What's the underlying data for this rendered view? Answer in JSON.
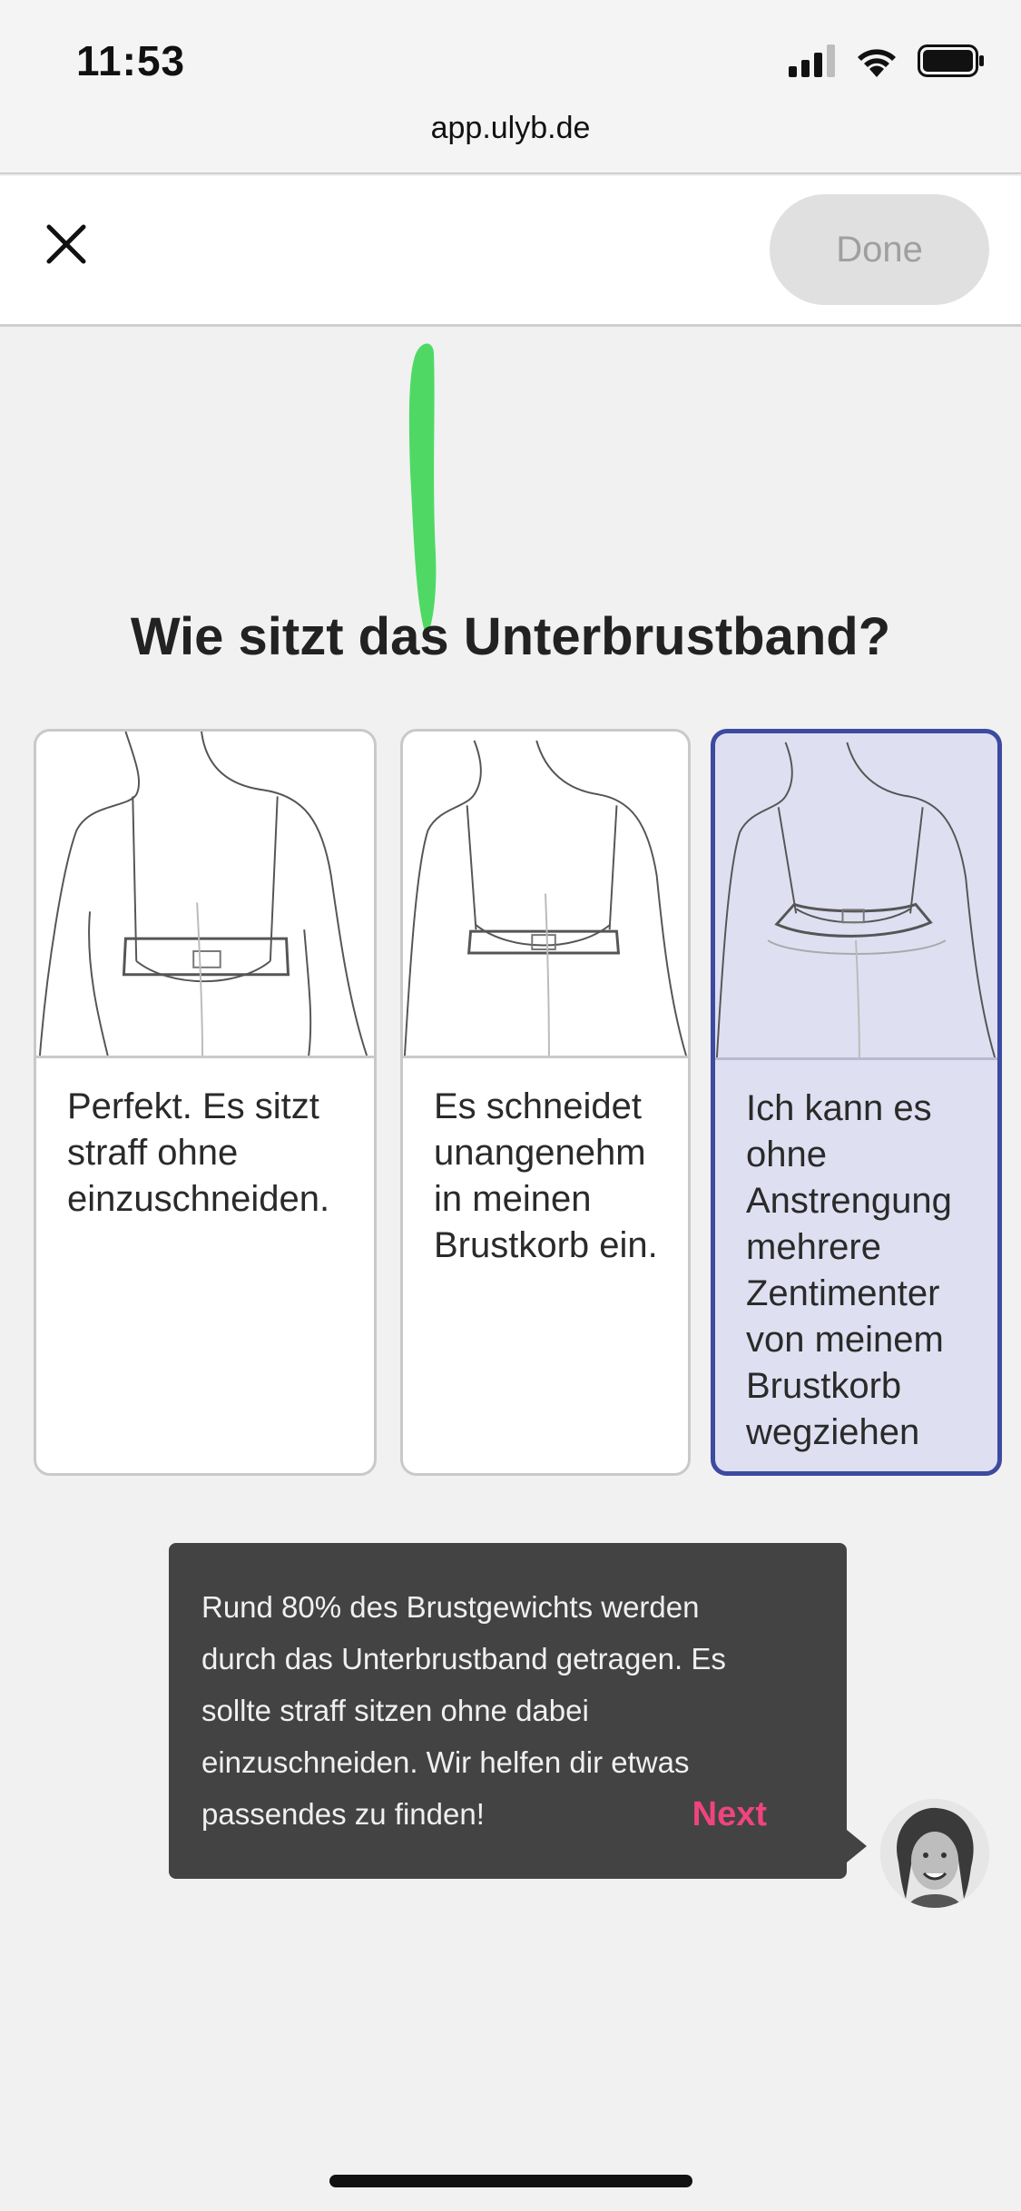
{
  "status_bar": {
    "time": "11:53"
  },
  "browser": {
    "url": "app.ulyb.de"
  },
  "top_bar": {
    "done_label": "Done"
  },
  "question": "Wie sitzt das Unterbrustband?",
  "options": [
    {
      "text": "Perfekt. Es sitzt straff ohne einzuschneiden.",
      "selected": false
    },
    {
      "text": "Es schneidet unangenehm in meinen Brustkorb ein.",
      "selected": false
    },
    {
      "text": "Ich kann es ohne Anstrengung mehrere Zentimenter von meinem Brustkorb wegziehen",
      "selected": true
    }
  ],
  "tooltip": {
    "text": "Rund 80% des Brustgewichts werden durch das Unterbrustband getragen. Es sollte straff sitzen ohne dabei einzuschneiden. Wir helfen dir etwas passendes zu finden!",
    "next_label": "Next"
  },
  "colors": {
    "accent_pink": "#f0447e",
    "selected_border": "#3c4aa0",
    "selected_bg": "#dfdff2",
    "scribble_green": "#4fd964"
  }
}
